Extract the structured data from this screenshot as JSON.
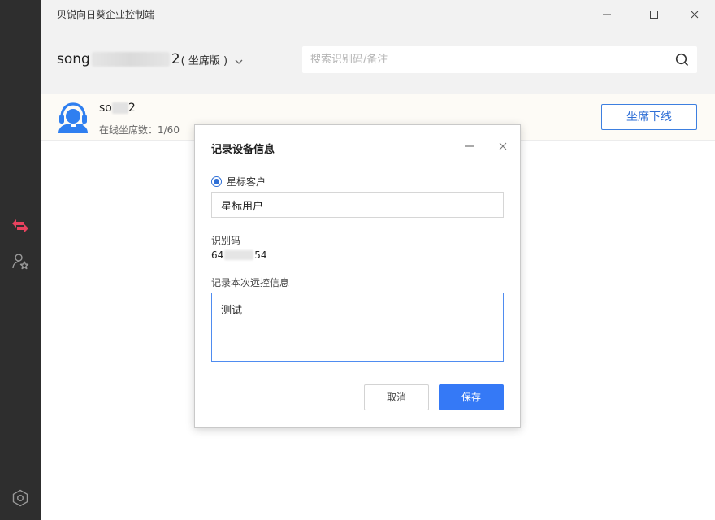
{
  "window": {
    "title": "贝锐向日葵企业控制端"
  },
  "sidebar": {
    "items": [
      {
        "icon": "transfer-arrows-icon",
        "active": true
      },
      {
        "icon": "user-star-icon",
        "active": false
      },
      {
        "icon": "settings-hexagon-icon",
        "active": false
      }
    ]
  },
  "header": {
    "account_prefix": "song",
    "account_suffix": "2",
    "edition": "( 坐席版 )",
    "search_placeholder": "搜索识别码/备注"
  },
  "device": {
    "name_prefix": "so",
    "name_suffix": "2",
    "online_seats": "在线坐席数：1/60",
    "offline_button": "坐席下线"
  },
  "dialog": {
    "title": "记录设备信息",
    "radio_label": "星标客户",
    "name_value": "星标用户",
    "code_label": "识别码",
    "code_prefix": "64",
    "code_suffix": "54",
    "remark_label": "记录本次远控信息",
    "remark_value": "测试",
    "cancel": "取消",
    "save": "保存"
  },
  "colors": {
    "accent": "#3579f6",
    "sidebar_bg": "#2e2e2e",
    "active_icon": "#e8425f"
  }
}
